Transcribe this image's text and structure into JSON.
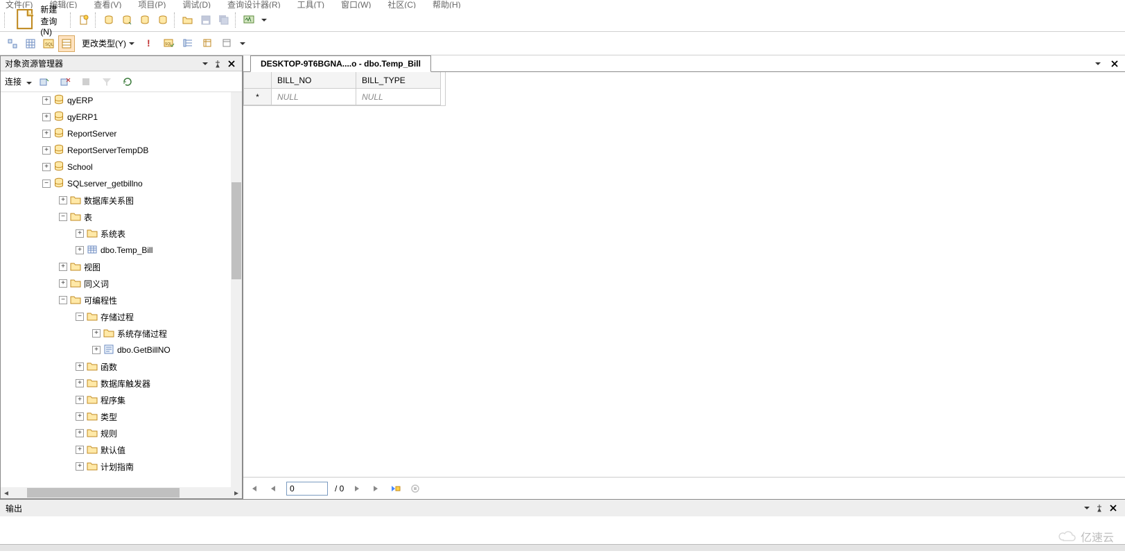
{
  "menubar": [
    "文件(F)",
    "编辑(E)",
    "查看(V)",
    "项目(P)",
    "调试(D)",
    "查询设计器(R)",
    "工具(T)",
    "窗口(W)",
    "社区(C)",
    "帮助(H)"
  ],
  "toolbar1": {
    "new_query": "新建查询(N)"
  },
  "toolbar2": {
    "change_type": "更改类型(Y)"
  },
  "explorer": {
    "title": "对象资源管理器",
    "connect_label": "连接",
    "tree": [
      {
        "indent": 60,
        "exp": "+",
        "icon": "db",
        "label": "qyERP"
      },
      {
        "indent": 60,
        "exp": "+",
        "icon": "db",
        "label": "qyERP1"
      },
      {
        "indent": 60,
        "exp": "+",
        "icon": "db",
        "label": "ReportServer"
      },
      {
        "indent": 60,
        "exp": "+",
        "icon": "db",
        "label": "ReportServerTempDB"
      },
      {
        "indent": 60,
        "exp": "+",
        "icon": "db",
        "label": "School"
      },
      {
        "indent": 60,
        "exp": "-",
        "icon": "db",
        "label": "SQLserver_getbillno"
      },
      {
        "indent": 84,
        "exp": "+",
        "icon": "folder",
        "label": "数据库关系图"
      },
      {
        "indent": 84,
        "exp": "-",
        "icon": "folder",
        "label": "表"
      },
      {
        "indent": 108,
        "exp": "+",
        "icon": "folder",
        "label": "系统表"
      },
      {
        "indent": 108,
        "exp": "+",
        "icon": "table",
        "label": "dbo.Temp_Bill"
      },
      {
        "indent": 84,
        "exp": "+",
        "icon": "folder",
        "label": "视图"
      },
      {
        "indent": 84,
        "exp": "+",
        "icon": "folder",
        "label": "同义词"
      },
      {
        "indent": 84,
        "exp": "-",
        "icon": "folder",
        "label": "可编程性"
      },
      {
        "indent": 108,
        "exp": "-",
        "icon": "folder",
        "label": "存储过程"
      },
      {
        "indent": 132,
        "exp": "+",
        "icon": "folder",
        "label": "系统存储过程"
      },
      {
        "indent": 132,
        "exp": "+",
        "icon": "sp",
        "label": "dbo.GetBillNO"
      },
      {
        "indent": 108,
        "exp": "+",
        "icon": "folder",
        "label": "函数"
      },
      {
        "indent": 108,
        "exp": "+",
        "icon": "folder",
        "label": "数据库触发器"
      },
      {
        "indent": 108,
        "exp": "+",
        "icon": "folder",
        "label": "程序集"
      },
      {
        "indent": 108,
        "exp": "+",
        "icon": "folder",
        "label": "类型"
      },
      {
        "indent": 108,
        "exp": "+",
        "icon": "folder",
        "label": "规则"
      },
      {
        "indent": 108,
        "exp": "+",
        "icon": "folder",
        "label": "默认值"
      },
      {
        "indent": 108,
        "exp": "+",
        "icon": "folder",
        "label": "计划指南"
      }
    ]
  },
  "document": {
    "tab_title": "DESKTOP-9T6BGNA....o - dbo.Temp_Bill",
    "columns": [
      "BILL_NO",
      "BILL_TYPE"
    ],
    "rowhead": "*",
    "cells": [
      "NULL",
      "NULL"
    ],
    "nav": {
      "current": "0",
      "total": "/ 0"
    }
  },
  "output": {
    "title": "输出"
  },
  "watermark": "亿速云"
}
